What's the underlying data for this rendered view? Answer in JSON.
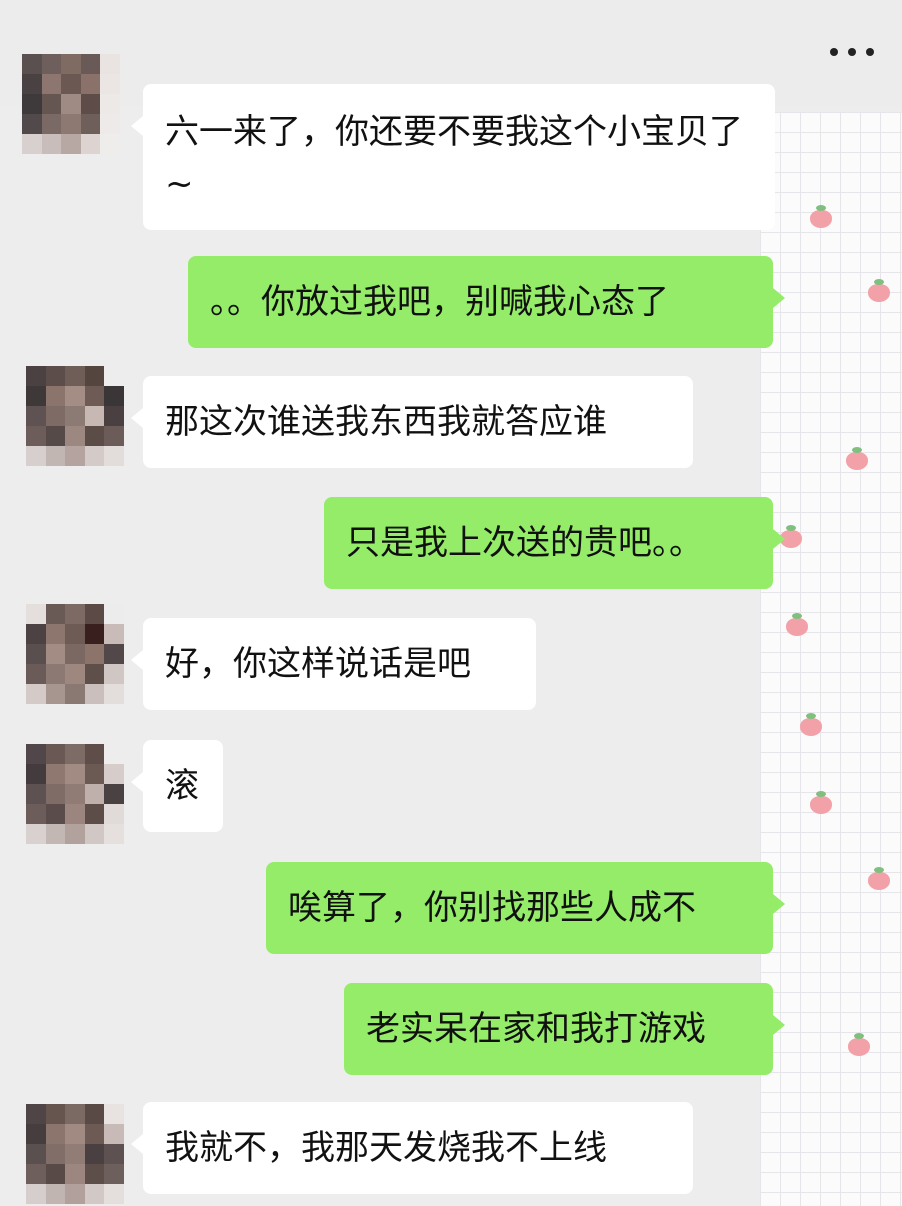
{
  "header": {
    "more_icon": "more-horizontal-icon"
  },
  "messages": [
    {
      "side": "in",
      "text": "六一来了，你还要不要我这个小宝贝了~"
    },
    {
      "side": "out",
      "text": "。。你放过我吧，别喊我心态了"
    },
    {
      "side": "in",
      "text": "那这次谁送我东西我就答应谁"
    },
    {
      "side": "out",
      "text": "只是我上次送的贵吧。。"
    },
    {
      "side": "in",
      "text": "好，你这样说话是吧"
    },
    {
      "side": "in",
      "text": "滚"
    },
    {
      "side": "out",
      "text": "唉算了，你别找那些人成不"
    },
    {
      "side": "out",
      "text": "老实呆在家和我打游戏"
    },
    {
      "side": "in",
      "text": "我就不，我那天发烧我不上线"
    }
  ],
  "colors": {
    "incoming_bubble": "#ffffff",
    "outgoing_bubble": "#95ec69",
    "background": "#ededed"
  }
}
